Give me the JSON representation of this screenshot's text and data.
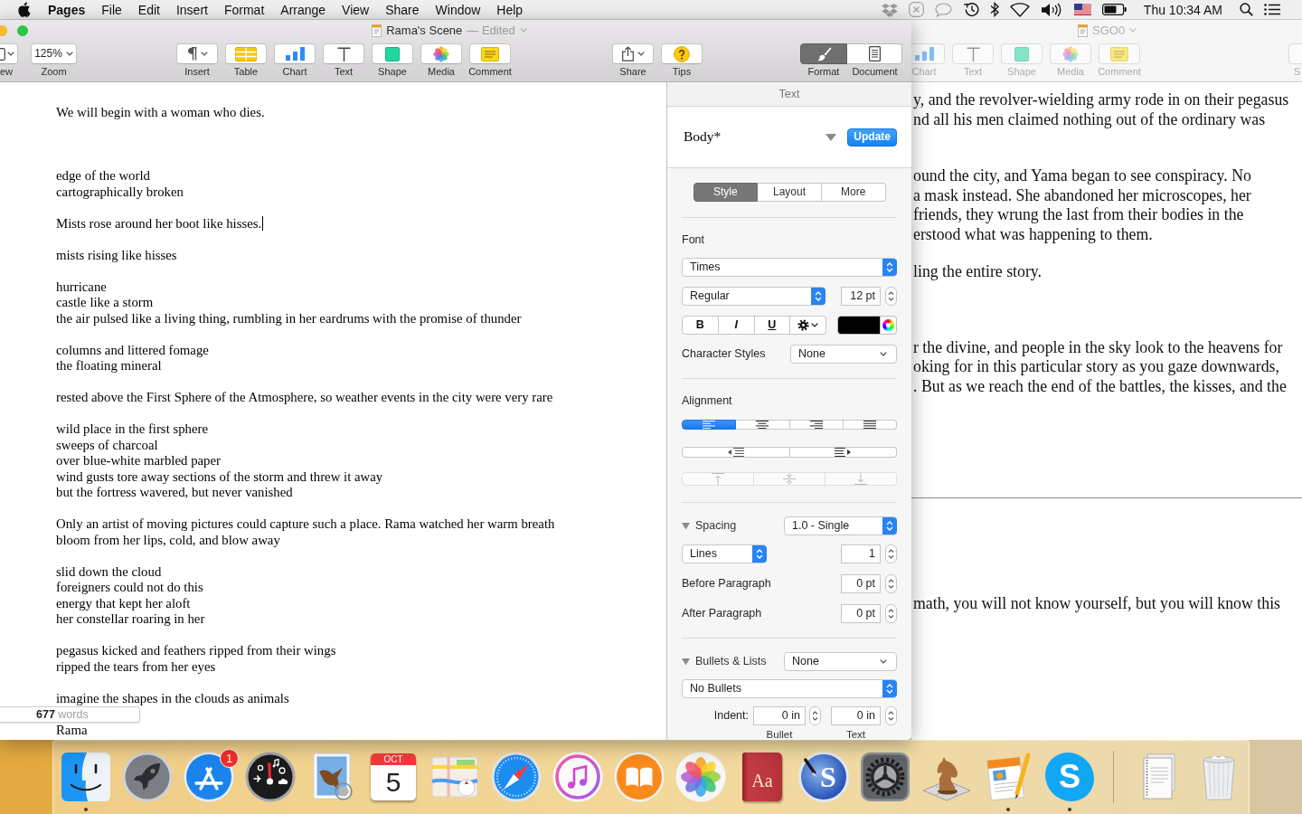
{
  "menu_bar": {
    "app_name": "Pages",
    "menus": [
      "File",
      "Edit",
      "Insert",
      "Format",
      "Arrange",
      "View",
      "Share",
      "Window",
      "Help"
    ],
    "clock": "Thu 10:34 AM"
  },
  "main_window": {
    "title": "Rama's Scene",
    "title_status": "— Edited",
    "toolbar": {
      "items": [
        {
          "kind": "view",
          "label": "ew"
        },
        {
          "kind": "zoom",
          "label": "Zoom",
          "value": "125%"
        },
        {
          "kind": "insert",
          "label": "Insert"
        },
        {
          "kind": "table",
          "label": "Table"
        },
        {
          "kind": "chart",
          "label": "Chart"
        },
        {
          "kind": "text",
          "label": "Text"
        },
        {
          "kind": "shape",
          "label": "Shape"
        },
        {
          "kind": "media",
          "label": "Media"
        },
        {
          "kind": "comment",
          "label": "Comment"
        },
        {
          "kind": "share",
          "label": "Share"
        },
        {
          "kind": "tips",
          "label": "Tips"
        }
      ],
      "inspector_switch": [
        {
          "label": "Format",
          "selected": true
        },
        {
          "label": "Document",
          "selected": false
        }
      ]
    },
    "document": {
      "paragraphs": [
        {
          "lines": [
            "We will begin with a woman who dies."
          ],
          "caret": false
        },
        {
          "lines": [
            "edge of the world",
            "cartographically broken"
          ],
          "caret": false
        },
        {
          "lines": [
            "Mists rose around her boot like hisses."
          ],
          "caret": true
        },
        {
          "lines": [
            "mists rising like hisses"
          ],
          "caret": false
        },
        {
          "lines": [
            "hurricane",
            "castle like a storm",
            "the air pulsed like a living thing, rumbling in her eardrums with the promise of thunder"
          ],
          "caret": false
        },
        {
          "lines": [
            "columns and littered fomage",
            "the floating mineral"
          ],
          "caret": false
        },
        {
          "lines": [
            "rested above the First Sphere of the Atmosphere, so weather events in the city were very rare"
          ],
          "caret": false
        },
        {
          "lines": [
            "wild place in the first sphere",
            "sweeps of charcoal",
            "over blue-white marbled paper",
            "wind gusts tore away sections of the storm and threw it away",
            "but the fortress wavered, but never vanished"
          ],
          "caret": false
        },
        {
          "lines": [
            "Only an artist of moving pictures could capture such a place. Rama watched her warm breath bloom from her lips, cold, and blow away"
          ],
          "caret": false
        },
        {
          "lines": [
            "slid down the cloud",
            "foreigners could not do this",
            "energy that kept her aloft",
            "her constellar roaring in her"
          ],
          "caret": false
        },
        {
          "lines": [
            "pegasus kicked and feathers ripped from their wings",
            "ripped the tears from her eyes"
          ],
          "caret": false
        },
        {
          "lines": [
            "imagine the shapes in the clouds as animals"
          ],
          "caret": false
        },
        {
          "lines": [
            "Rama"
          ],
          "caret": false
        }
      ],
      "word_count": "**677** words"
    },
    "inspector": {
      "header": "Text",
      "paragraph_style": "Body*",
      "update_button": "Update",
      "tabs": [
        {
          "label": "Style",
          "selected": true
        },
        {
          "label": "Layout",
          "selected": false
        },
        {
          "label": "More",
          "selected": false
        }
      ],
      "font": {
        "heading": "Font",
        "family": "Times",
        "typeface": "Regular",
        "size": "12 pt",
        "styles": [
          {
            "kind": "bold",
            "label": "B"
          },
          {
            "kind": "italic",
            "label": "I"
          },
          {
            "kind": "underline",
            "label": "U"
          },
          {
            "kind": "options"
          }
        ],
        "color": "#000000"
      },
      "character_styles": {
        "label": "Character Styles",
        "value": "None"
      },
      "alignment": {
        "heading": "Alignment",
        "horizontal": [
          {
            "kind": "left",
            "selected": true
          },
          {
            "kind": "center",
            "selected": false
          },
          {
            "kind": "right",
            "selected": false
          },
          {
            "kind": "justify",
            "selected": false
          }
        ],
        "indent": [
          {
            "kind": "decrease"
          },
          {
            "kind": "increase"
          }
        ],
        "vertical": [
          {
            "kind": "top",
            "disabled": true
          },
          {
            "kind": "middle",
            "disabled": true
          },
          {
            "kind": "bottom",
            "disabled": true
          }
        ]
      },
      "spacing": {
        "heading": "Spacing",
        "expanded": true,
        "preset": "1.0 - Single",
        "unit": "Lines",
        "value": "1",
        "before_label": "Before Paragraph",
        "before": "0 pt",
        "after_label": "After Paragraph",
        "after": "0 pt"
      },
      "bullets": {
        "heading": "Bullets & Lists",
        "expanded": true,
        "preset": "None",
        "style": "No Bullets",
        "indent_label": "Indent:",
        "bullet_indent": "0 in",
        "text_indent": "0 in",
        "bullet_caption": "Bullet",
        "text_caption": "Text"
      }
    }
  },
  "right_window": {
    "title": "SGO0",
    "toolbar": [
      {
        "kind": "chart",
        "label": "Chart"
      },
      {
        "kind": "text",
        "label": "Text"
      },
      {
        "kind": "shape",
        "label": "Shape"
      },
      {
        "kind": "media",
        "label": "Media"
      },
      {
        "kind": "comment",
        "label": "Comment"
      },
      {
        "kind": "partial",
        "label": "S"
      }
    ],
    "pages": [
      {
        "paragraphs": [
          {
            "lines": [
              "y, and the revolver-wielding army rode in on their pegasus",
              "nd all his men claimed nothing out of the ordinary was"
            ]
          },
          {
            "lines": [
              "ound the city, and Yama began to see conspiracy. No",
              "a mask instead. She abandoned her microscopes, her",
              "friends, they wrung the last from their bodies in the",
              "erstood what was happening to them."
            ]
          },
          {
            "lines": [
              "ling the entire story."
            ]
          },
          {
            "lines": [
              "r the divine, and people in the sky look to the heavens for",
              "oking for in this particular story as you gaze downwards,",
              ". But as we reach the end of the battles, the kisses, and the"
            ]
          }
        ]
      },
      {
        "paragraphs": [
          {
            "lines": [
              "math, you will not know yourself, but you will know this"
            ]
          }
        ]
      }
    ]
  },
  "dock": {
    "apps": [
      {
        "kind": "face",
        "running": true
      },
      {
        "kind": "rocket",
        "running": false
      },
      {
        "kind": "appstore",
        "running": false,
        "badge": "1"
      },
      {
        "kind": "gauge",
        "running": false
      },
      {
        "kind": "stamp",
        "running": false
      },
      {
        "kind": "calendar",
        "running": false,
        "month": "OCT",
        "day": "5"
      },
      {
        "kind": "map",
        "running": false
      },
      {
        "kind": "compass",
        "running": false
      },
      {
        "kind": "music",
        "running": false
      },
      {
        "kind": "book",
        "running": false
      },
      {
        "kind": "petals",
        "running": false
      },
      {
        "kind": "dictionary",
        "running": false,
        "label": "Aa"
      },
      {
        "kind": "pen",
        "running": false,
        "label": "S"
      },
      {
        "kind": "gear",
        "running": false
      },
      {
        "kind": "chess",
        "running": false
      },
      {
        "kind": "pages",
        "running": true
      },
      {
        "kind": "cloud",
        "running": true,
        "label": "S"
      }
    ],
    "stacks": [
      {
        "kind": "documents"
      },
      {
        "kind": "trash"
      }
    ]
  }
}
